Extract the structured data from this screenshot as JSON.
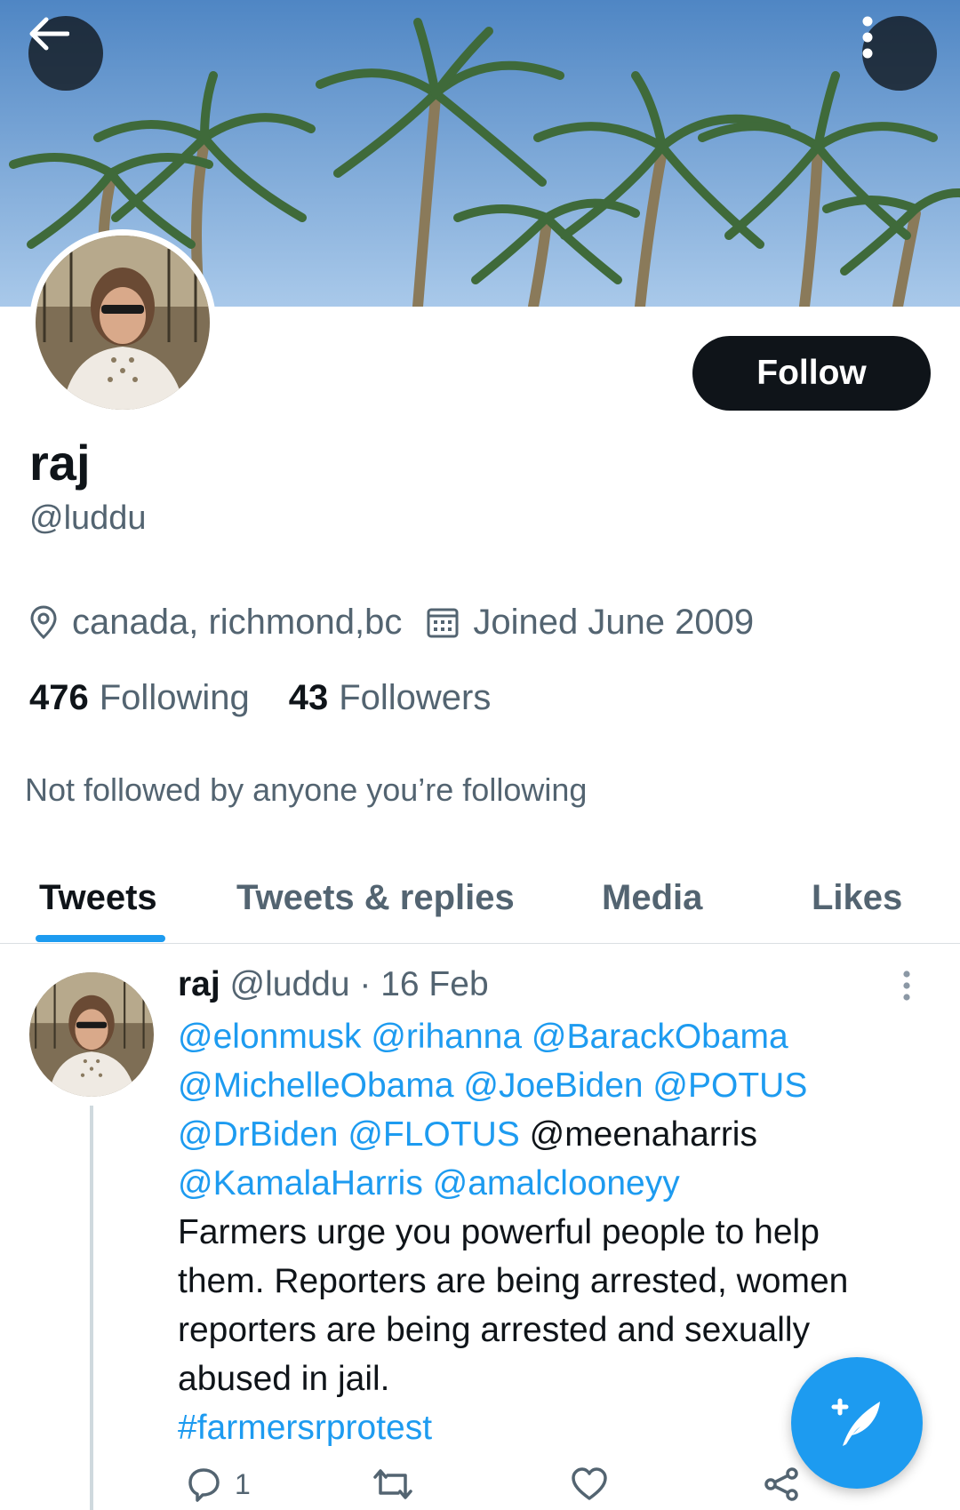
{
  "header": {
    "back_icon": "arrow-left-icon",
    "more_icon": "more-vertical-icon"
  },
  "profile": {
    "display_name": "raj",
    "handle": "@luddu",
    "follow_label": "Follow",
    "location": "canada, richmond,bc",
    "joined": "Joined June 2009",
    "following_count": "476",
    "following_label": "Following",
    "followers_count": "43",
    "followers_label": "Followers",
    "not_followed_text": "Not followed by anyone you’re following"
  },
  "tabs": [
    {
      "label": "Tweets",
      "active": true
    },
    {
      "label": "Tweets & replies",
      "active": false
    },
    {
      "label": "Media",
      "active": false
    },
    {
      "label": "Likes",
      "active": false
    }
  ],
  "tweet": {
    "name": "raj",
    "handle_date": "@luddu · 16 Feb",
    "mentions_line1": "@elonmusk @rihanna @BarackObama",
    "mentions_line2": "@MichelleObama @JoeBiden @POTUS",
    "mentions_line3a": "@DrBiden @FLOTUS",
    "mentions_line3b": "@meenaharris",
    "mentions_line4": "@KamalaHarris @amalclooneyy",
    "text_line1": "Farmers urge you powerful people to help",
    "text_line2": "them. Reporters are being arrested, women",
    "text_line3": "reporters are being arrested and sexually",
    "text_line4": "abused in jail.",
    "hashtag": "#farmersrprotest",
    "reply_count": "1"
  },
  "colors": {
    "accent": "#1d9bf0",
    "text_primary": "#0f1419",
    "text_secondary": "#536471"
  }
}
